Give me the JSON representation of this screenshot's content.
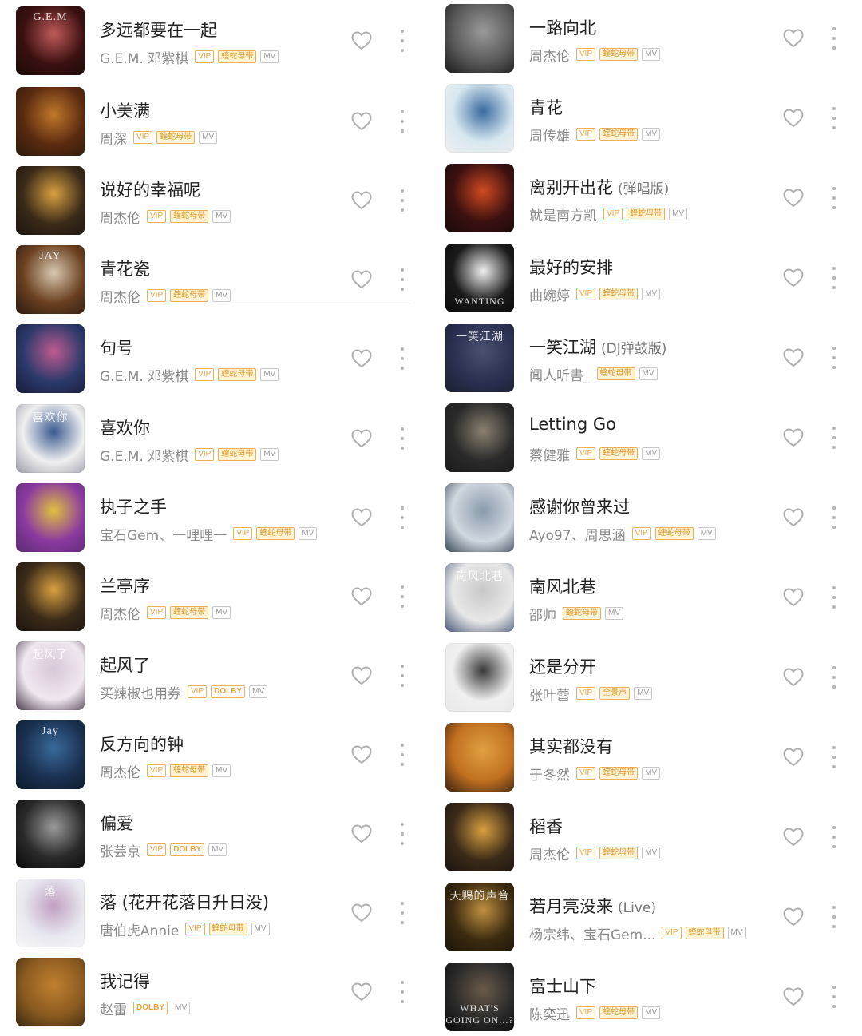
{
  "left_column": [
    {
      "title": "多远都要在一起",
      "title_suffix": "",
      "artist": "G.E.M. 邓紫棋",
      "badges": [
        "VIP",
        "蝰蛇母带",
        "MV"
      ],
      "cover_text": "G.E.M",
      "cover_colors": [
        "#3a1010",
        "#c05a5a",
        "#1a0a0a"
      ]
    },
    {
      "title": "小美满",
      "title_suffix": "",
      "artist": "周深",
      "badges": [
        "VIP",
        "蝰蛇母带",
        "MV"
      ],
      "cover_text": "",
      "cover_colors": [
        "#5a2a10",
        "#c0782a",
        "#2a1a0a"
      ]
    },
    {
      "title": "说好的幸福呢",
      "title_suffix": "",
      "artist": "周杰伦",
      "badges": [
        "VIP",
        "蝰蛇母带",
        "MV"
      ],
      "cover_text": "",
      "cover_colors": [
        "#3a2a18",
        "#d8a040",
        "#1a1410"
      ]
    },
    {
      "title": "青花瓷",
      "title_suffix": "",
      "artist": "周杰伦",
      "badges": [
        "VIP",
        "蝰蛇母带",
        "MV"
      ],
      "cover_text": "JAY",
      "cover_colors": [
        "#6a4020",
        "#d8c8b0",
        "#2a1a10"
      ]
    },
    {
      "title": "句号",
      "title_suffix": "",
      "artist": "G.E.M. 邓紫棋",
      "badges": [
        "VIP",
        "蝰蛇母带",
        "MV"
      ],
      "cover_text": "",
      "cover_colors": [
        "#2a3a6a",
        "#c05a90",
        "#1a1a3a"
      ]
    },
    {
      "title": "喜欢你",
      "title_suffix": "",
      "artist": "G.E.M. 邓紫棋",
      "badges": [
        "VIP",
        "蝰蛇母带",
        "MV"
      ],
      "cover_text": "喜欢你",
      "cover_colors": [
        "#f0f0f0",
        "#3a5a90",
        "#9a9aa8"
      ]
    },
    {
      "title": "执子之手",
      "title_suffix": "",
      "artist": "宝石Gem、一哩哩一",
      "badges": [
        "VIP",
        "蝰蛇母带",
        "MV"
      ],
      "cover_text": "",
      "cover_colors": [
        "#8a3aa0",
        "#e0c040",
        "#5a2a70"
      ]
    },
    {
      "title": "兰亭序",
      "title_suffix": "",
      "artist": "周杰伦",
      "badges": [
        "VIP",
        "蝰蛇母带",
        "MV"
      ],
      "cover_text": "",
      "cover_colors": [
        "#3a2a18",
        "#d8a040",
        "#1a1410"
      ]
    },
    {
      "title": "起风了",
      "title_suffix": "",
      "artist": "买辣椒也用券",
      "badges": [
        "VIP",
        "DOLBY",
        "MV"
      ],
      "cover_text": "起风了",
      "cover_colors": [
        "#f0e8f0",
        "#d8c8d8",
        "#4a3a4a"
      ]
    },
    {
      "title": "反方向的钟",
      "title_suffix": "",
      "artist": "周杰伦",
      "badges": [
        "VIP",
        "蝰蛇母带",
        "MV"
      ],
      "cover_text": "Jay",
      "cover_colors": [
        "#1a3050",
        "#3a6a9a",
        "#0a1a2a"
      ]
    },
    {
      "title": "偏爱",
      "title_suffix": "",
      "artist": "张芸京",
      "badges": [
        "VIP",
        "DOLBY",
        "MV"
      ],
      "cover_text": "",
      "cover_colors": [
        "#2a2a2a",
        "#9a9a9a",
        "#0a0a0a"
      ]
    },
    {
      "title": "落 (花开花落日升日没)",
      "title_suffix": "",
      "artist": "唐伯虎Annie",
      "badges": [
        "VIP",
        "蝰蛇母带",
        "MV"
      ],
      "cover_text": "落",
      "cover_colors": [
        "#e8e8f0",
        "#c0a0c0",
        "#f8f8f8"
      ]
    },
    {
      "title": "我记得",
      "title_suffix": "",
      "artist": "赵雷",
      "badges": [
        "DOLBY",
        "MV"
      ],
      "cover_text": "",
      "cover_colors": [
        "#8a5a20",
        "#c08030",
        "#3a2a10"
      ]
    }
  ],
  "right_column": [
    {
      "title": "一路向北",
      "title_suffix": "",
      "artist": "周杰伦",
      "badges": [
        "VIP",
        "蝰蛇母带",
        "MV"
      ],
      "cover_text": "",
      "cover_colors": [
        "#5a5a5a",
        "#9a9a9a",
        "#1a1a1a"
      ]
    },
    {
      "title": "青花",
      "title_suffix": "",
      "artist": "周传雄",
      "badges": [
        "VIP",
        "蝰蛇母带",
        "MV"
      ],
      "cover_text": "",
      "cover_colors": [
        "#d8e8f0",
        "#3a6aa0",
        "#f0f0f0"
      ]
    },
    {
      "title": "离别开出花",
      "title_suffix": "(弹唱版)",
      "artist": "就是南方凯",
      "badges": [
        "VIP",
        "蝰蛇母带",
        "MV"
      ],
      "cover_text": "",
      "cover_colors": [
        "#3a1010",
        "#d04a20",
        "#1a0a0a"
      ]
    },
    {
      "title": "最好的安排",
      "title_suffix": "",
      "artist": "曲婉婷",
      "badges": [
        "VIP",
        "蝰蛇母带",
        "MV"
      ],
      "cover_text": "WANTING",
      "cover_colors": [
        "#1a1a1a",
        "#f0f0f0",
        "#0a0a0a"
      ]
    },
    {
      "title": "一笑江湖",
      "title_suffix": "(DJ弹鼓版)",
      "artist": "闻人听書_",
      "badges": [
        "蝰蛇母带",
        "MV"
      ],
      "cover_text": "一笑江湖",
      "cover_colors": [
        "#2a3050",
        "#4a5070",
        "#1a2030"
      ]
    },
    {
      "title": "Letting Go",
      "title_suffix": "",
      "artist": "蔡健雅",
      "badges": [
        "VIP",
        "蝰蛇母带",
        "MV"
      ],
      "cover_text": "",
      "cover_colors": [
        "#2a2a2a",
        "#8a8070",
        "#1a1a1a"
      ]
    },
    {
      "title": "感谢你曾来过",
      "title_suffix": "",
      "artist": "Ayo97、周思涵",
      "badges": [
        "VIP",
        "蝰蛇母带",
        "MV"
      ],
      "cover_text": "",
      "cover_colors": [
        "#d0d8e0",
        "#8a9aaa",
        "#3a4a5a"
      ]
    },
    {
      "title": "南风北巷",
      "title_suffix": "",
      "artist": "邵帅",
      "badges": [
        "蝰蛇母带",
        "MV"
      ],
      "cover_text": "南风北巷",
      "cover_colors": [
        "#e8e8e8",
        "#c8c8c8",
        "#4a5a7a"
      ]
    },
    {
      "title": "还是分开",
      "title_suffix": "",
      "artist": "张叶蕾",
      "badges": [
        "VIP",
        "全景声",
        "MV"
      ],
      "cover_text": "",
      "cover_colors": [
        "#f0f0f0",
        "#3a3a3a",
        "#e8e8e8"
      ]
    },
    {
      "title": "其实都没有",
      "title_suffix": "",
      "artist": "于冬然",
      "badges": [
        "VIP",
        "蝰蛇母带",
        "MV"
      ],
      "cover_text": "",
      "cover_colors": [
        "#c07020",
        "#e0a040",
        "#3a2010"
      ]
    },
    {
      "title": "稻香",
      "title_suffix": "",
      "artist": "周杰伦",
      "badges": [
        "VIP",
        "蝰蛇母带",
        "MV"
      ],
      "cover_text": "",
      "cover_colors": [
        "#3a2a18",
        "#d8a040",
        "#1a1410"
      ]
    },
    {
      "title": "若月亮没来",
      "title_suffix": "(Live)",
      "artist": "杨宗纬、宝石Gem...",
      "badges": [
        "VIP",
        "蝰蛇母带",
        "MV"
      ],
      "cover_text": "天赐的声音",
      "cover_colors": [
        "#3a2a10",
        "#c09040",
        "#1a1408"
      ]
    },
    {
      "title": "富士山下",
      "title_suffix": "",
      "artist": "陈奕迅",
      "badges": [
        "VIP",
        "蝰蛇母带",
        "MV"
      ],
      "cover_text": "WHAT'S GOING ON...?",
      "cover_colors": [
        "#2a2a2a",
        "#6a5a4a",
        "#0a0a0a"
      ]
    }
  ],
  "icons": {
    "like": "heart-outline-icon",
    "more": "more-vertical-icon"
  },
  "colors": {
    "badge_gold": "#e8a33a",
    "text_primary": "#222222",
    "text_secondary": "#8a8a8a"
  }
}
